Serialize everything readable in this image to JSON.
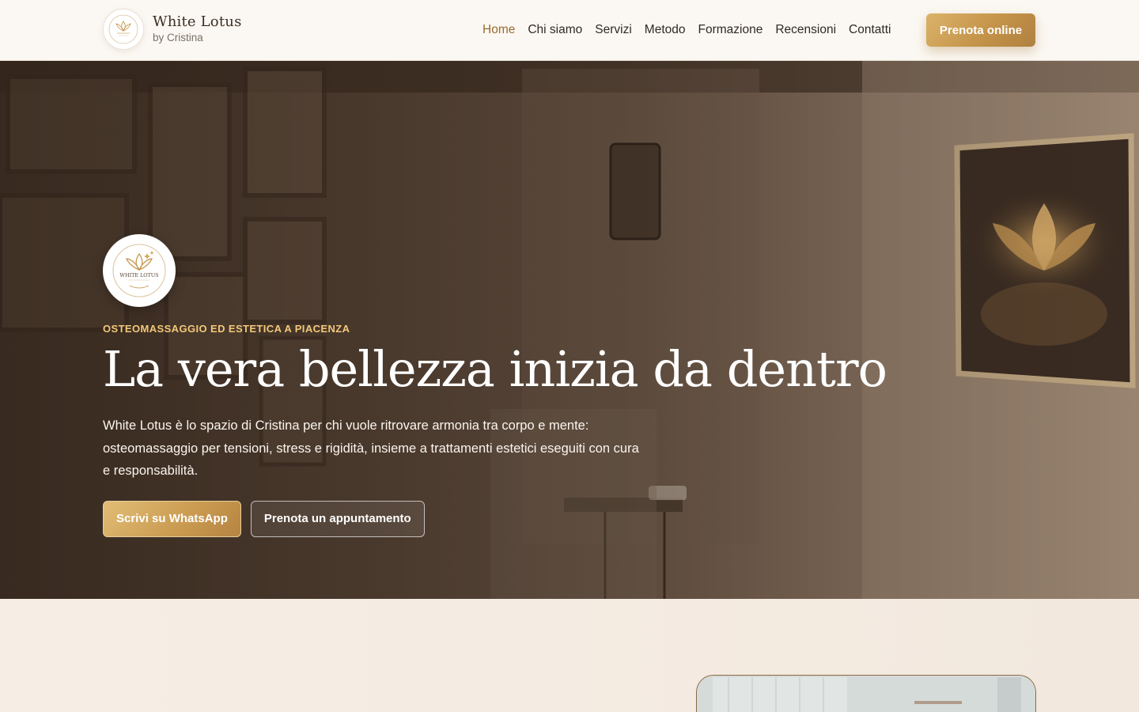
{
  "header": {
    "brand_name": "White Lotus",
    "brand_sub": "by Cristina",
    "logo_text": "WHITE LOTUS",
    "nav": [
      {
        "label": "Home",
        "active": true
      },
      {
        "label": "Chi siamo",
        "active": false
      },
      {
        "label": "Servizi",
        "active": false
      },
      {
        "label": "Metodo",
        "active": false
      },
      {
        "label": "Formazione",
        "active": false
      },
      {
        "label": "Recensioni",
        "active": false
      },
      {
        "label": "Contatti",
        "active": false
      }
    ],
    "cta_label": "Prenota online"
  },
  "hero": {
    "eyebrow": "OSTEOMASSAGGIO ED ESTETICA A PIACENZA",
    "title": "La vera bellezza inizia da dentro",
    "description": "White Lotus è lo spazio di Cristina per chi vuole ritrovare armonia tra corpo e mente: osteomassaggio per tensioni, stress e rigidità, insieme a trattamenti estetici eseguiti con cura e responsabilità.",
    "primary_button": "Scrivi su WhatsApp",
    "secondary_button": "Prenota un appuntamento"
  },
  "colors": {
    "accent_gold": "#c4944a",
    "eyebrow_gold": "#f2c879",
    "nav_active": "#9a6a2e",
    "header_bg": "#fbf8f3",
    "section_bg": "#f3e9df"
  },
  "icons": {
    "brand_logo": "lotus-logo-icon",
    "hero_logo": "lotus-logo-icon"
  }
}
